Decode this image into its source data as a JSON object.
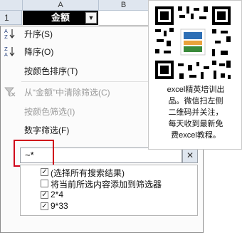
{
  "sheet": {
    "row_number": "1",
    "columns": [
      "A",
      "B"
    ],
    "cell_a1": "金额",
    "dropdown_arrow": "▼"
  },
  "menu": {
    "sort_asc": "升序(S)",
    "sort_desc": "降序(O)",
    "sort_color": "按颜色排序(T)",
    "clear_filter": "从“金额”中清除筛选(C)",
    "color_filter": "按颜色筛选(I)",
    "number_filter": "数字筛选(F)",
    "icons": {
      "sort_asc": "A↓Z",
      "sort_desc": "Z↓A",
      "clear_filter": "funnel-clear-icon"
    }
  },
  "search": {
    "value": "~*",
    "clear_label": "✕"
  },
  "list": {
    "items": [
      {
        "label": "(选择所有搜索结果)",
        "checked": true
      },
      {
        "label": "将当前所选内容添加到筛选器",
        "checked": false
      },
      {
        "label": "2*4",
        "checked": true
      },
      {
        "label": "9*33",
        "checked": true
      }
    ]
  },
  "promo": {
    "lines": [
      "excel精英培训出",
      "品。微信扫左侧",
      "二维码并关注，",
      "每天收到最新免",
      "费excel教程。"
    ]
  },
  "colors": {
    "header_bg": "#dfe6ef",
    "highlight_red": "#d0021b",
    "selected_cell": "#000000"
  }
}
